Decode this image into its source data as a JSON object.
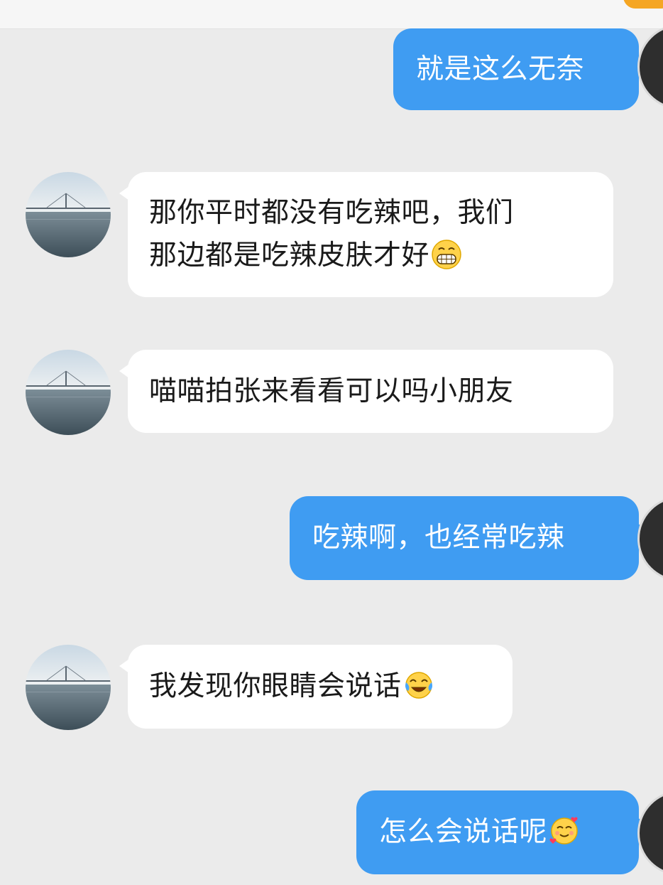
{
  "messages": [
    {
      "side": "out",
      "text": "就是这么无奈"
    },
    {
      "side": "in",
      "lines": [
        "那你平时都没有吃辣吧，我们",
        "那边都是吃辣皮肤才好"
      ],
      "emoji": "grinning-face-icon"
    },
    {
      "side": "in",
      "text": "喵喵拍张来看看可以吗小朋友"
    },
    {
      "side": "out",
      "text": "吃辣啊，也经常吃辣"
    },
    {
      "side": "in",
      "text": "我发现你眼睛会说话",
      "emoji": "laughing-tears-face-icon"
    },
    {
      "side": "out",
      "text": "怎么会说话呢",
      "emoji": "smiling-hearts-face-icon"
    }
  ],
  "colors": {
    "background": "#ebebeb",
    "incoming_bubble": "#ffffff",
    "outgoing_bubble": "#3f9cf2",
    "incoming_text": "#1a1a1a",
    "outgoing_text": "#ffffff",
    "badge": "#f5a623"
  }
}
